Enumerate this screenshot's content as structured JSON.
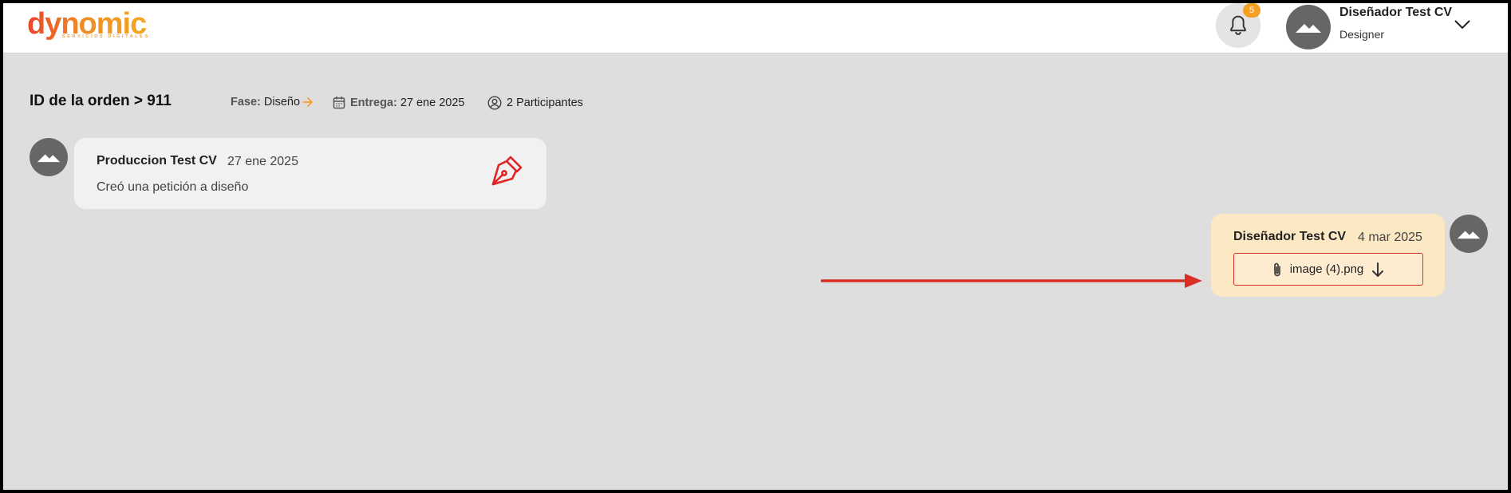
{
  "brand": {
    "name": "dynomic",
    "tagline": "SERVICIOS DIGITALES"
  },
  "header": {
    "notifications_count": "5",
    "user_name": "Diseñador Test CV",
    "user_role": "Designer"
  },
  "order": {
    "title": "ID de la orden > 911",
    "phase_label": "Fase:",
    "phase_value": "Diseño",
    "delivery_label": "Entrega:",
    "delivery_value": "27 ene 2025",
    "participants": "2 Participantes"
  },
  "messages": [
    {
      "author": "Produccion Test CV",
      "date": "27 ene 2025",
      "text": "Creó una petición a diseño",
      "icon": "pen-nib-icon"
    },
    {
      "author": "Diseñador Test CV",
      "date": "4 mar 2025",
      "attachment": "image (4).png"
    }
  ],
  "colors": {
    "accent_orange": "#f4a024",
    "annotation_red": "#d93025",
    "bubble_left": "#f1f1f1",
    "bubble_right": "#fde8c4",
    "background": "#dedede"
  }
}
